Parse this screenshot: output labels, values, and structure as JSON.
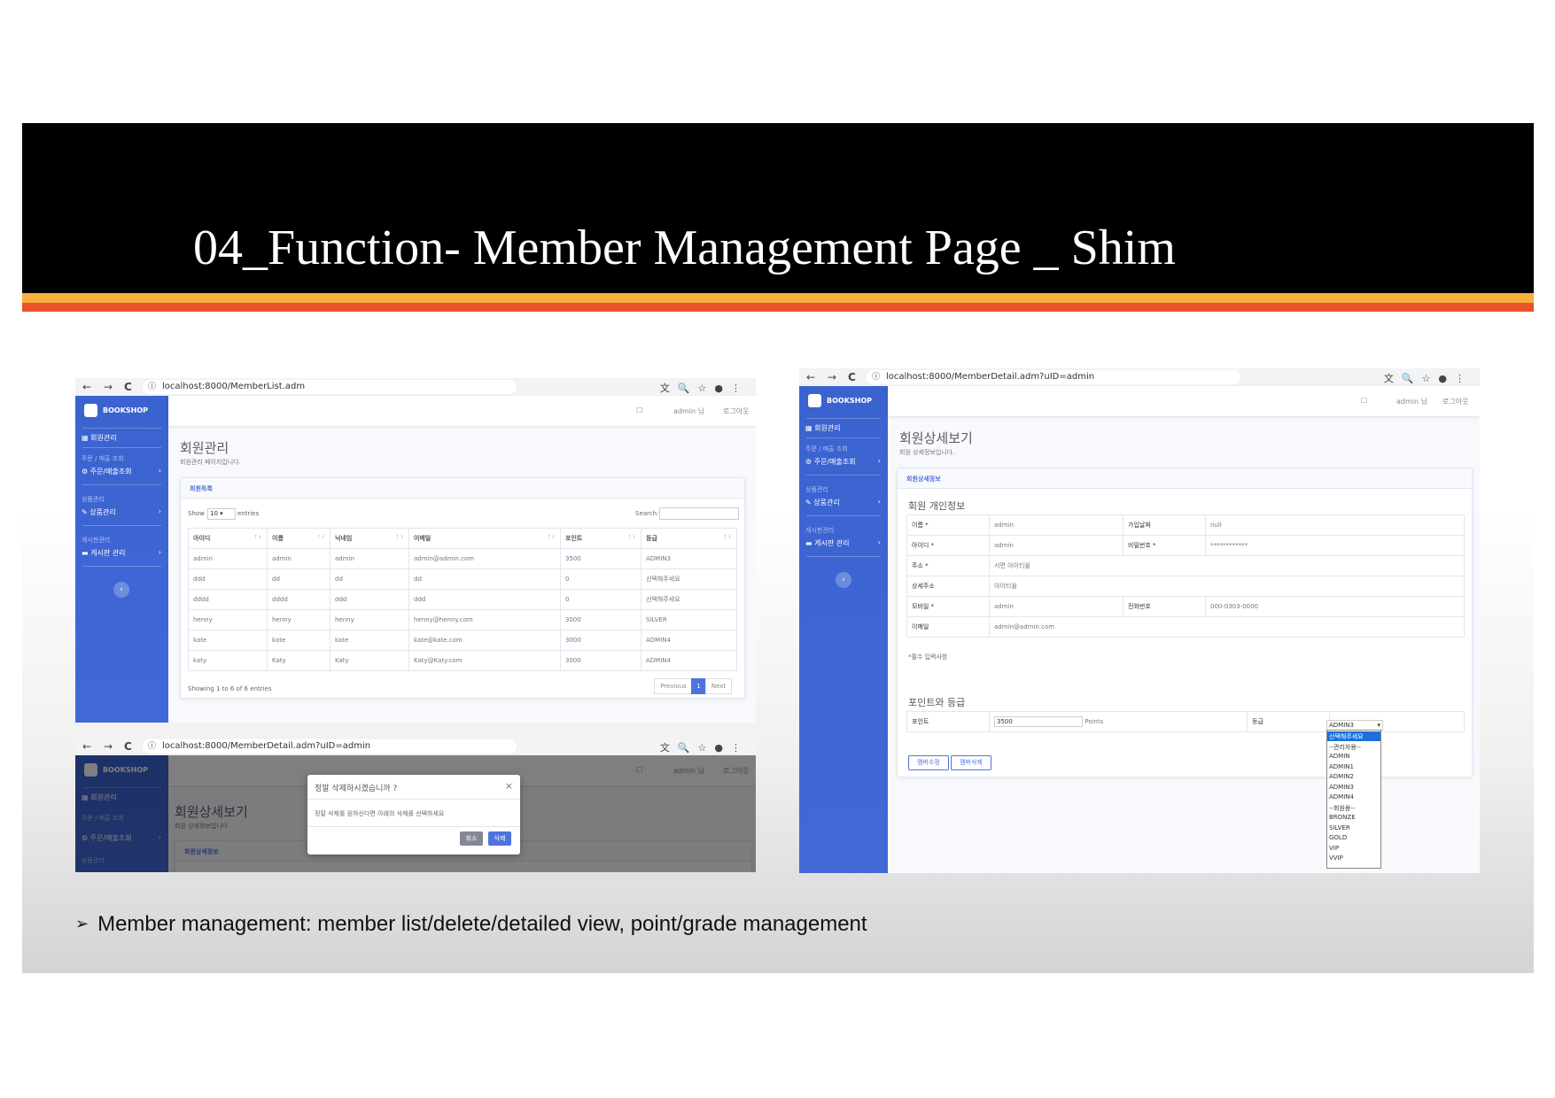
{
  "slide": {
    "title": "04_Function- Member Management Page _ Shim",
    "bullet_marker": "➢",
    "bullet_text": "Member management: member list/delete/detailed  view, point/grade management"
  },
  "colors": {
    "title_band": "#000000",
    "stripe_yellow": "#f8ae3c",
    "stripe_orange": "#e8532a",
    "sidebar_blue": "#3a63cf",
    "accent": "#4e73df"
  },
  "common": {
    "brand": "BOOKSHOP",
    "nav_back": "←",
    "nav_forward": "→",
    "nav_reload": "C",
    "browser_icons": [
      "translate-icon",
      "zoom-icon",
      "star-icon",
      "account-icon",
      "menu-icon"
    ],
    "topbar_user": "admin 님",
    "topbar_logout": "로그아웃",
    "sidebar": {
      "member_mgmt": "회원관리",
      "order_header": "주문 / 매출 조회",
      "order_item": "주문/매출조회",
      "product_header": "상품관리",
      "product_item": "상품관리",
      "board_header": "게시판관리",
      "board_item": "게시판 관리"
    }
  },
  "list_shot": {
    "url": "localhost:8000/MemberList.adm",
    "page_title": "회원관리",
    "page_subtitle": "회원관리 페이지입니다.",
    "card_title": "회원목록",
    "show_label": "Show",
    "show_value": "10",
    "entries_label": "entries",
    "search_label": "Search:",
    "columns": [
      "아이디",
      "이름",
      "닉네임",
      "이메일",
      "포인트",
      "등급"
    ],
    "rows": [
      [
        "admin",
        "admin",
        "admin",
        "admin@admin.com",
        "3500",
        "ADMIN3"
      ],
      [
        "ddd",
        "dd",
        "dd",
        "dd",
        "0",
        "선택해주세요"
      ],
      [
        "dddd",
        "dddd",
        "ddd",
        "ddd",
        "0",
        "선택해주세요"
      ],
      [
        "henny",
        "henny",
        "henny",
        "henny@henny.com",
        "3000",
        "SILVER"
      ],
      [
        "kate",
        "kate",
        "kate",
        "kate@kate.com",
        "3000",
        "ADMIN4"
      ],
      [
        "katy",
        "Katy",
        "Katy",
        "Katy@Katy.com",
        "3000",
        "ADMIN4"
      ]
    ],
    "info": "Showing 1 to 6 of 6 entries",
    "prev": "Previous",
    "page": "1",
    "next": "Next"
  },
  "delete_shot": {
    "url": "localhost:8000/MemberDetail.adm?uID=admin",
    "page_title": "회원상세보기",
    "page_subtitle": "회원 상세정보입니다",
    "card_title": "회원상세정보",
    "modal_title": "정말 삭제하시겠습니까 ?",
    "modal_close": "×",
    "modal_body": "정말 삭제를 원하신다면 아래의 삭제를 선택하세요",
    "cancel": "취소",
    "delete": "삭제"
  },
  "detail_shot": {
    "url": "localhost:8000/MemberDetail.adm?uID=admin",
    "page_title": "회원상세보기",
    "page_subtitle": "회원 상세정보입니다.",
    "card_title": "회원상세정보",
    "section1": "회원 개인정보",
    "fields": {
      "name_label": "이름 *",
      "name_value": "admin",
      "join_label": "가입날짜",
      "join_value": "null",
      "id_label": "아이디 *",
      "id_value": "admin",
      "pw_label": "비밀번호 *",
      "pw_value": "************",
      "addr_label": "주소 *",
      "addr_value": "서면 아이티윌",
      "addr2_label": "상세주소",
      "addr2_value": "아이티윌",
      "mobile_label": "모바일 *",
      "mobile_value": "admin",
      "phone_label": "전화번호",
      "phone_value": "000-0303-0000",
      "email_label": "이메일",
      "email_value": "admin@admin.com"
    },
    "required_note": "*필수 입력사항",
    "section2": "포인트와 등급",
    "point_label": "포인트",
    "point_value": "3500",
    "points_unit": "Points",
    "grade_label": "등급",
    "grade_selected": "ADMIN3",
    "grade_options": [
      "선택해주세요",
      "--관리자용--",
      "ADMIN",
      "ADMIN1",
      "ADMIN2",
      "ADMIN3",
      "ADMIN4",
      "--회원용--",
      "BRONZE",
      "SILVER",
      "GOLD",
      "VIP",
      "VVIP"
    ],
    "edit_button": "멤버수정",
    "delete_button": "멤버삭제"
  }
}
